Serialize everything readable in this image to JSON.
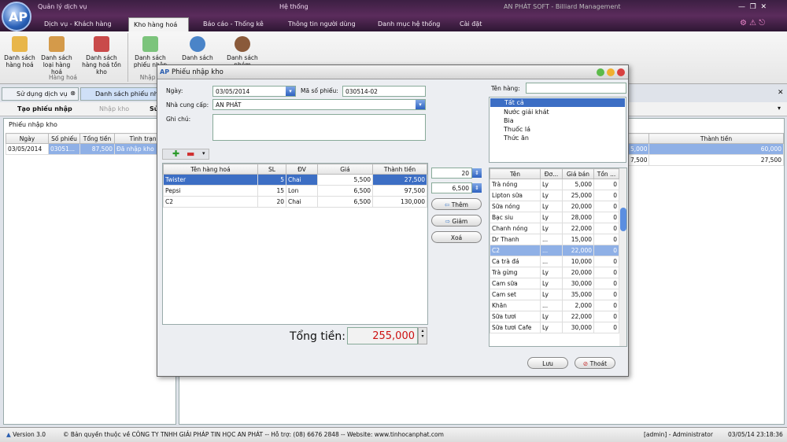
{
  "window_title": "Quản lý dịch vụ",
  "menu_system": "Hệ thống",
  "app_brand": "AN PHÁT SOFT - Billiard Management",
  "logo_text": "AP",
  "tabs": [
    "Dịch vụ - Khách hàng",
    "Kho hàng hoá",
    "Báo cáo - Thống kê",
    "Thông tin người dùng",
    "Danh mục hệ thống",
    "Cài đặt"
  ],
  "ribbon": {
    "buttons": [
      "Danh sách hàng hoá",
      "Danh sách loại hàng hoá",
      "Danh sách hàng hoá tồn kho",
      "Danh sách phiếu nhập",
      "Danh sách",
      "Danh sách nhóm"
    ],
    "group1": "Hàng hoá",
    "group2": "Nhập k"
  },
  "doc_tabs": [
    "Sử dụng dịch vụ",
    "Danh sách phiếu nhập"
  ],
  "toolbar": {
    "create": "Tạo phiếu nhập",
    "import": "Nhập kho",
    "edit": "Sử"
  },
  "list": {
    "title": "Phiếu nhập kho",
    "columns": [
      "Ngày",
      "Số phiếu",
      "Tổng tiền",
      "Tình trạng"
    ],
    "rows": [
      [
        "03/05/2014",
        "03051...",
        "87,500",
        "Đã nhập kho"
      ]
    ]
  },
  "right_list": {
    "column": "Thành tiền",
    "rows": [
      [
        "5,000",
        "60,000"
      ],
      [
        "7,500",
        "27,500"
      ]
    ]
  },
  "dialog": {
    "title": "Phiếu nhập kho",
    "date_label": "Ngày:",
    "date": "03/05/2014",
    "receipt_label": "Mã số phiếu:",
    "receipt": "030514-02",
    "supplier_label": "Nhà cung cấp:",
    "supplier": "AN PHÁT",
    "note_label": "Ghi chú:",
    "note": "",
    "grid_columns": [
      "Tên hàng hoá",
      "SL",
      "ĐV",
      "Giá",
      "Thành tiền"
    ],
    "grid_rows": [
      {
        "name": "Twister",
        "qty": "5",
        "unit": "Chai",
        "price": "5,500",
        "total": "27,500"
      },
      {
        "name": "Pepsi",
        "qty": "15",
        "unit": "Lon",
        "price": "6,500",
        "total": "97,500"
      },
      {
        "name": "C2",
        "qty": "20",
        "unit": "Chai",
        "price": "6,500",
        "total": "130,000"
      }
    ],
    "qty_value": "20",
    "price_value": "6,500",
    "btn_add": "Thêm",
    "btn_decrease": "Giảm",
    "btn_delete": "Xoá",
    "total_label": "Tổng tiền:",
    "total_value": "255,000",
    "product_name_label": "Tên hàng:",
    "categories": [
      "Tất cả",
      "Nước giải khát",
      "Bia",
      "Thuốc lá",
      "Thức ăn"
    ],
    "product_columns": [
      "Tên",
      "Đơ...",
      "Giá bán",
      "Tồn ..."
    ],
    "products": [
      [
        "Trà nóng",
        "Ly",
        "5,000",
        "0"
      ],
      [
        "Lipton sữa",
        "Ly",
        "25,000",
        "0"
      ],
      [
        "Sữa nóng",
        "Ly",
        "20,000",
        "0"
      ],
      [
        "Bạc siu",
        "Ly",
        "28,000",
        "0"
      ],
      [
        "Chanh nóng",
        "Ly",
        "22,000",
        "0"
      ],
      [
        "Dr Thanh",
        "...",
        "15,000",
        "0"
      ],
      [
        "C2",
        "...",
        "22,000",
        "0"
      ],
      [
        "Ca trà đá",
        "...",
        "10,000",
        "0"
      ],
      [
        "Trà gừng",
        "Ly",
        "20,000",
        "0"
      ],
      [
        "Cam sữa",
        "Ly",
        "30,000",
        "0"
      ],
      [
        "Cam set",
        "Ly",
        "35,000",
        "0"
      ],
      [
        "Khăn",
        "...",
        "2,000",
        "0"
      ],
      [
        "Sữa tươi",
        "Ly",
        "22,000",
        "0"
      ],
      [
        "Sữa tươi Cafe",
        "Ly",
        "30,000",
        "0"
      ]
    ],
    "btn_save": "Lưu",
    "btn_exit": "Thoát"
  },
  "status": {
    "version": "Version 3.0",
    "copyright": "© Bản quyền thuộc về CÔNG TY TNHH GIẢI PHÁP TIN HỌC AN PHÁT  -- Hỗ trợ: (08) 6676 2848  -- Website: www.tinhocanphat.com",
    "user": "[admin] - Administrator",
    "datetime": "03/05/14 23:18:36"
  },
  "colors": {
    "header": "#4a2450",
    "selection": "#3c6ec4",
    "total": "#cc1111"
  }
}
